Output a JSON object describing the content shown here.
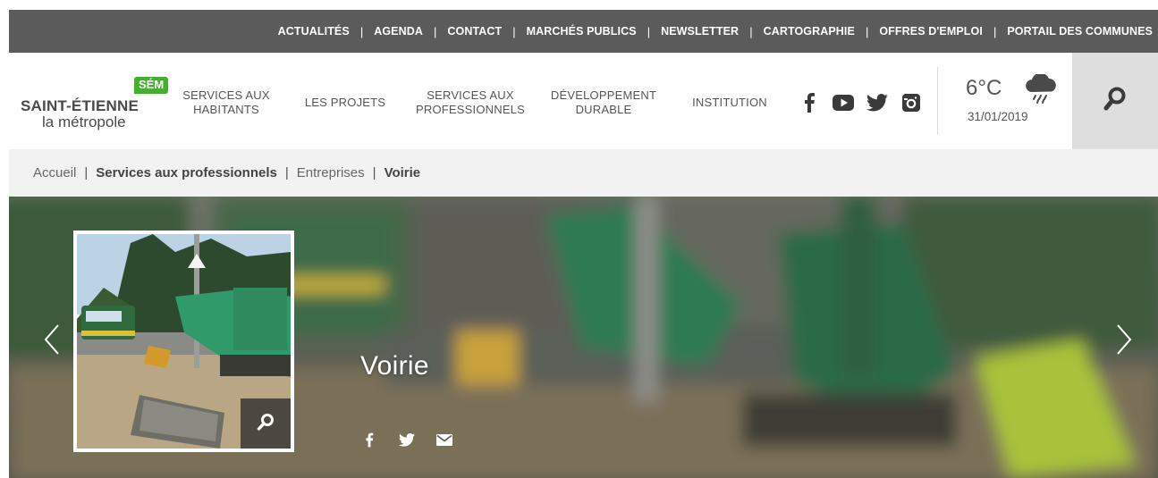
{
  "top_links": [
    "ACTUALITÉS",
    "AGENDA",
    "CONTACT",
    "MARCHÉS PUBLICS",
    "NEWSLETTER",
    "CARTOGRAPHIE",
    "OFFRES D'EMPLOI",
    "PORTAIL DES COMMUNES"
  ],
  "top_separator": "|",
  "logo": {
    "badge": "SÉM",
    "line1": "SAINT-ÉTIENNE",
    "line2": "la métropole",
    "badge_color": "#44b02e"
  },
  "nav": [
    {
      "line1": "SERVICES AUX",
      "line2": "HABITANTS"
    },
    {
      "line1": "LES PROJETS",
      "line2": ""
    },
    {
      "line1": "SERVICES AUX",
      "line2": "PROFESSIONNELS"
    },
    {
      "line1": "DÉVELOPPEMENT",
      "line2": "DURABLE"
    },
    {
      "line1": "INSTITUTION",
      "line2": ""
    }
  ],
  "social_icons": [
    "facebook-icon",
    "youtube-icon",
    "twitter-icon",
    "instagram-icon"
  ],
  "weather": {
    "temperature": "6°C",
    "date": "31/01/2019",
    "icon": "rain-cloud-icon"
  },
  "search_icon": "search-icon",
  "breadcrumb": {
    "items": [
      "Accueil",
      "Services aux professionnels",
      "Entreprises",
      "Voirie"
    ],
    "separator": "|"
  },
  "hero": {
    "title": "Voirie",
    "share_icons": [
      "facebook-icon",
      "twitter-icon",
      "mail-icon"
    ],
    "prev_icon": "chevron-left-icon",
    "next_icon": "chevron-right-icon",
    "zoom_icon": "search-icon"
  },
  "colors": {
    "topbar": "#5b5b5b",
    "search_bg": "#dedede",
    "breadcrumb_bg": "#f2f2f2",
    "text": "#555555"
  }
}
